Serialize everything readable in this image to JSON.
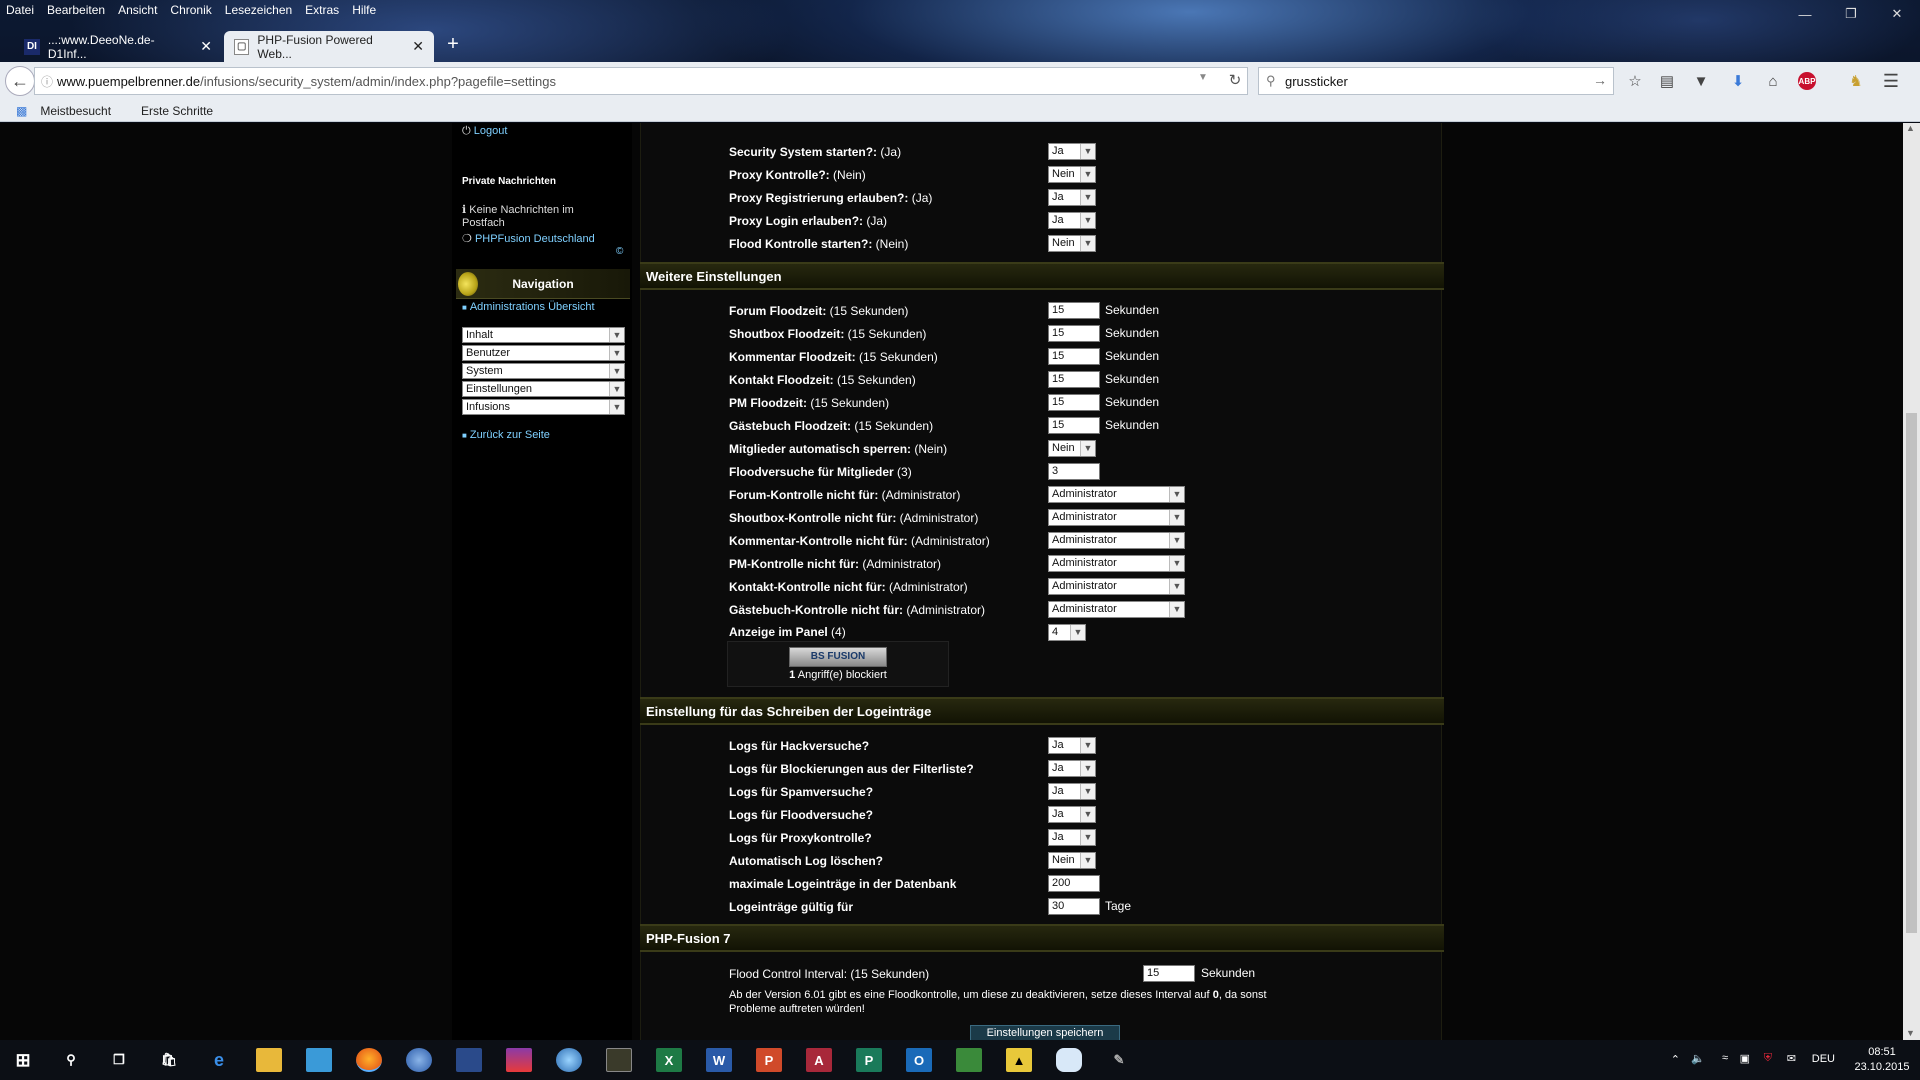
{
  "menubar": {
    "items": [
      "Datei",
      "Bearbeiten",
      "Ansicht",
      "Chronik",
      "Lesezeichen",
      "Extras",
      "Hilfe"
    ]
  },
  "tabs": [
    {
      "favicon": "DI",
      "title": "...:www.DeeoNe.de-D1Inf...",
      "active": false
    },
    {
      "favicon": "tab-page-icon",
      "title": "PHP-Fusion Powered Web...",
      "active": true
    }
  ],
  "toolbar": {
    "url_host": "www.puempelbrenner.de",
    "url_path": "/infusions/security_system/admin/index.php?pagefile=settings",
    "search_value": "grussticker",
    "icons": [
      "star-icon",
      "reading-list-icon",
      "pocket-icon",
      "download-icon",
      "home-icon",
      "adblock-icon",
      "extension-icon",
      "menu-icon"
    ]
  },
  "bookmarks": [
    "Meistbesucht",
    "Erste Schritte"
  ],
  "sidebar": {
    "logout": "Logout",
    "pm_title": "Private Nachrichten",
    "pm_text": "Keine Nachrichten im Postfach",
    "pm_link": "PHPFusion Deutschland",
    "copyright": "©",
    "nav_title": "Navigation",
    "admin_link": "Administrations Übersicht",
    "selects": [
      "Inhalt",
      "Benutzer",
      "System",
      "Einstellungen",
      "Infusions"
    ],
    "back_link": "Zurück zur Seite"
  },
  "section1": {
    "rows": [
      {
        "label": "Security System starten?:",
        "note": "(Ja)",
        "value": "Ja"
      },
      {
        "label": "Proxy Kontrolle?:",
        "note": "(Nein)",
        "value": "Nein"
      },
      {
        "label": "Proxy Registrierung erlauben?:",
        "note": "(Ja)",
        "value": "Ja"
      },
      {
        "label": "Proxy Login erlauben?:",
        "note": "(Ja)",
        "value": "Ja"
      },
      {
        "label": "Flood Kontrolle starten?:",
        "note": "(Nein)",
        "value": "Nein"
      }
    ]
  },
  "section2": {
    "title": "Weitere Einstellungen",
    "flood_rows": [
      {
        "label": "Forum Floodzeit:",
        "note": "(15 Sekunden)",
        "value": "15",
        "unit": "Sekunden"
      },
      {
        "label": "Shoutbox Floodzeit:",
        "note": "(15 Sekunden)",
        "value": "15",
        "unit": "Sekunden"
      },
      {
        "label": "Kommentar Floodzeit:",
        "note": "(15 Sekunden)",
        "value": "15",
        "unit": "Sekunden"
      },
      {
        "label": "Kontakt Floodzeit:",
        "note": "(15 Sekunden)",
        "value": "15",
        "unit": "Sekunden"
      },
      {
        "label": "PM Floodzeit:",
        "note": "(15 Sekunden)",
        "value": "15",
        "unit": "Sekunden"
      },
      {
        "label": "Gästebuch Floodzeit:",
        "note": "(15 Sekunden)",
        "value": "15",
        "unit": "Sekunden"
      }
    ],
    "lock_label": "Mitglieder automatisch sperren:",
    "lock_note": "(Nein)",
    "lock_value": "Nein",
    "attempts_label": "Floodversuche für Mitglieder",
    "attempts_note": "(3)",
    "attempts_value": "3",
    "control_rows": [
      {
        "label": "Forum-Kontrolle nicht für:",
        "note": "(Administrator)",
        "value": "Administrator"
      },
      {
        "label": "Shoutbox-Kontrolle nicht für:",
        "note": "(Administrator)",
        "value": "Administrator"
      },
      {
        "label": "Kommentar-Kontrolle nicht für:",
        "note": "(Administrator)",
        "value": "Administrator"
      },
      {
        "label": "PM-Kontrolle nicht für:",
        "note": "(Administrator)",
        "value": "Administrator"
      },
      {
        "label": "Kontakt-Kontrolle nicht für:",
        "note": "(Administrator)",
        "value": "Administrator"
      },
      {
        "label": "Gästebuch-Kontrolle nicht für:",
        "note": "(Administrator)",
        "value": "Administrator"
      }
    ],
    "panel_label": "Anzeige im Panel",
    "panel_note": "(4)",
    "panel_value": "4",
    "badge_logo": "BS FUSION",
    "badge_count": "1",
    "badge_text": "Angriff(e) blockiert"
  },
  "section3": {
    "title": "Einstellung für das Schreiben der Logeinträge",
    "rows": [
      {
        "label": "Logs für Hackversuche?",
        "value": "Ja"
      },
      {
        "label": "Logs für Blockierungen aus der Filterliste?",
        "value": "Ja"
      },
      {
        "label": "Logs für Spamversuche?",
        "value": "Ja"
      },
      {
        "label": "Logs für Floodversuche?",
        "value": "Ja"
      },
      {
        "label": "Logs für Proxykontrolle?",
        "value": "Ja"
      },
      {
        "label": "Automatisch Log löschen?",
        "value": "Nein"
      }
    ],
    "max_label": "maximale Logeinträge in der Datenbank",
    "max_value": "200",
    "valid_label": "Logeinträge gültig für",
    "valid_value": "30",
    "valid_unit": "Tage"
  },
  "section4": {
    "title": "PHP-Fusion 7",
    "interval_label": "Flood Control Interval:",
    "interval_note": "(15 Sekunden)",
    "interval_value": "15",
    "interval_unit": "Sekunden",
    "note_line1": "Ab der Version 6.01 gibt es eine Floodkontrolle, um diese zu deaktivieren, setze dieses Interval auf",
    "note_bold": "0",
    "note_line2": ", da sonst Probleme auftreten würden!",
    "save_label": "Einstellungen speichern"
  },
  "taskbar": {
    "apps": [
      "start-icon",
      "search-icon",
      "task-view-icon",
      "store-icon",
      "edge-icon",
      "explorer-icon",
      "app-icon",
      "firefox-icon",
      "thunderbird-icon",
      "tool-icon",
      "archive-icon",
      "globe-icon",
      "film-icon",
      "excel-icon",
      "word-icon",
      "powerpoint-icon",
      "access-icon",
      "publisher-icon",
      "outlook-icon",
      "spreadsheet-icon",
      "batman-icon",
      "cloud-icon",
      "pen-icon"
    ],
    "lang": "DEU",
    "time": "08:51",
    "date": "23.10.2015"
  }
}
